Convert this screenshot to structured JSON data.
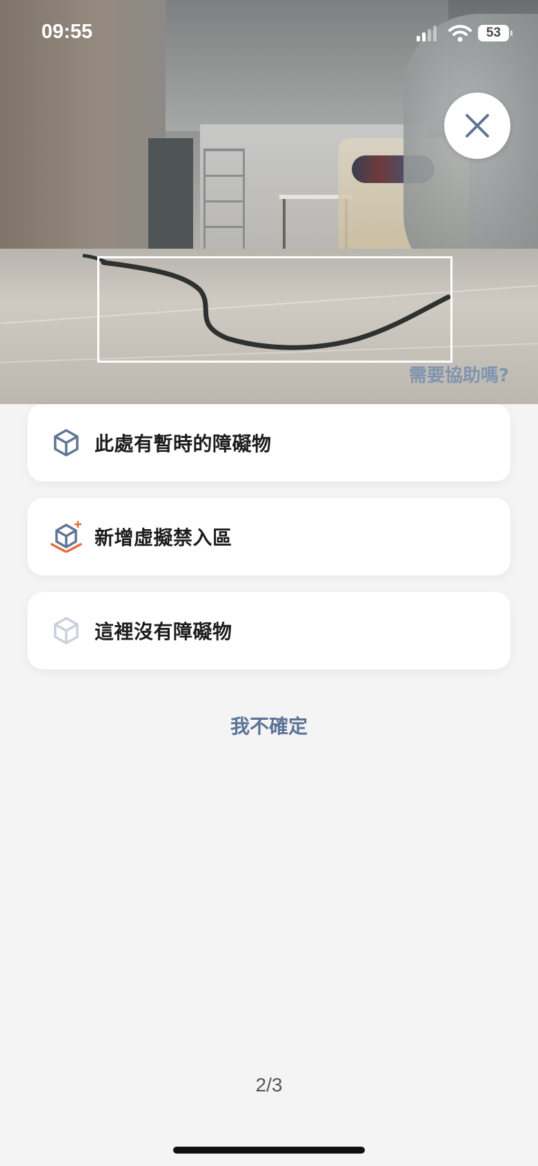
{
  "status_bar": {
    "time": "09:55",
    "battery": "53"
  },
  "camera": {
    "help_link": "需要協助嗎?"
  },
  "options": [
    {
      "label": "此處有暫時的障礙物",
      "icon": "cube-icon"
    },
    {
      "label": "新增虛擬禁入區",
      "icon": "cube-add-zone-icon"
    },
    {
      "label": "這裡沒有障礙物",
      "icon": "cube-light-icon"
    }
  ],
  "unsure_label": "我不確定",
  "pager": "2/3",
  "colors": {
    "accent_text": "#5a7394",
    "icon_blue": "#5f7594",
    "icon_orange": "#e56a3f",
    "icon_light": "#c9d1dc",
    "background": "#f4f4f4"
  }
}
